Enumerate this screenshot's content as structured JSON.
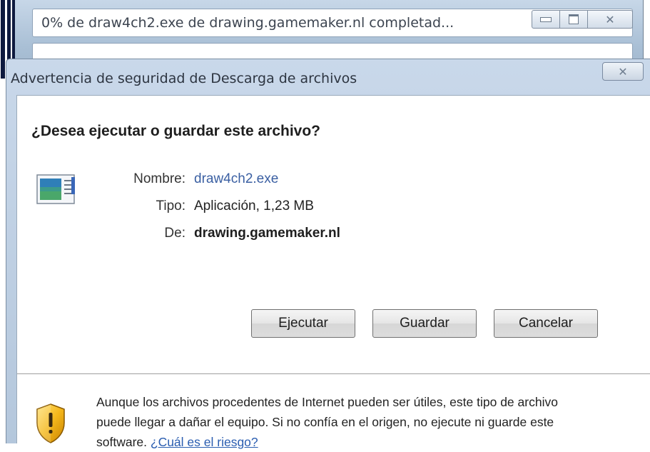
{
  "background_window": {
    "title": "0% de draw4ch2.exe de drawing.gamemaker.nl completad..."
  },
  "dialog": {
    "title": "Advertencia de seguridad de Descarga de archivos",
    "question": "¿Desea ejecutar o guardar este archivo?",
    "file": {
      "name_label": "Nombre:",
      "name_value": "draw4ch2.exe",
      "type_label": "Tipo:",
      "type_value": "Aplicación, 1,23 MB",
      "from_label": "De:",
      "from_value": "drawing.gamemaker.nl"
    },
    "buttons": {
      "run": "Ejecutar",
      "save": "Guardar",
      "cancel": "Cancelar"
    },
    "warning": {
      "text": "Aunque los archivos procedentes de Internet pueden ser útiles, este tipo de archivo puede llegar a dañar el equipo. Si no confía en el origen, no ejecute ni guarde este software. ",
      "link": "¿Cuál es el riesgo?"
    }
  },
  "icons": {
    "file": "application-file-icon",
    "shield": "security-shield-icon",
    "close": "close-icon",
    "minimize": "minimize-icon",
    "maximize": "maximize-icon"
  }
}
